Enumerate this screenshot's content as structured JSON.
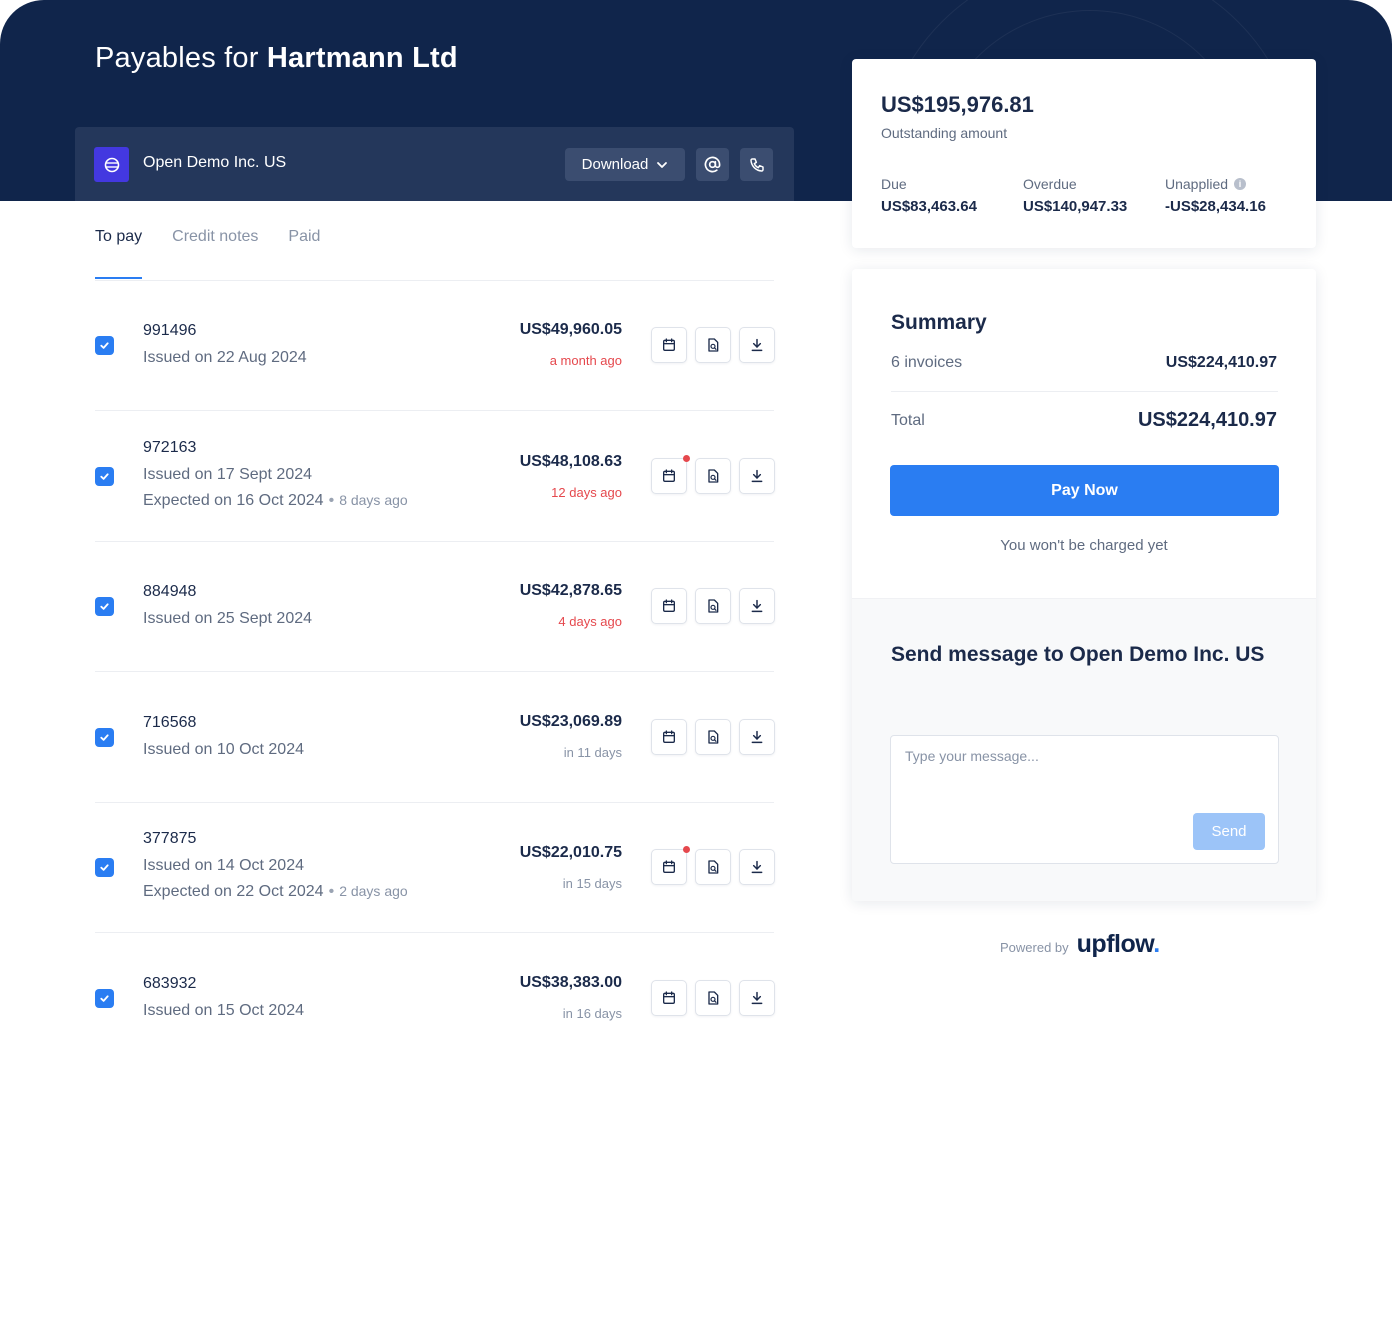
{
  "header": {
    "title_prefix": "Payables for",
    "title_company": "Hartmann Ltd"
  },
  "vendor": {
    "name": "Open Demo Inc. US",
    "download_label": "Download",
    "icons": [
      "globe-icon",
      "chevron-down-icon",
      "at-sign-icon",
      "phone-icon"
    ]
  },
  "tabs": [
    {
      "label": "To pay",
      "active": true
    },
    {
      "label": "Credit notes",
      "active": false
    },
    {
      "label": "Paid",
      "active": false
    }
  ],
  "invoices": [
    {
      "id": "991496",
      "issued": "Issued on 22 Aug 2024",
      "expected": "",
      "expected_ago": "",
      "amount": "US$49,960.05",
      "due": "a month ago",
      "overdue": true,
      "calendar_flag": false,
      "checked": true
    },
    {
      "id": "972163",
      "issued": "Issued on 17 Sept 2024",
      "expected": "Expected on 16 Oct 2024",
      "expected_ago": "8 days ago",
      "amount": "US$48,108.63",
      "due": "12 days ago",
      "overdue": true,
      "calendar_flag": true,
      "checked": true
    },
    {
      "id": "884948",
      "issued": "Issued on 25 Sept 2024",
      "expected": "",
      "expected_ago": "",
      "amount": "US$42,878.65",
      "due": "4 days ago",
      "overdue": true,
      "calendar_flag": false,
      "checked": true
    },
    {
      "id": "716568",
      "issued": "Issued on 10 Oct 2024",
      "expected": "",
      "expected_ago": "",
      "amount": "US$23,069.89",
      "due": "in 11 days",
      "overdue": false,
      "calendar_flag": false,
      "checked": true
    },
    {
      "id": "377875",
      "issued": "Issued on 14 Oct 2024",
      "expected": "Expected on 22 Oct 2024",
      "expected_ago": "2 days ago",
      "amount": "US$22,010.75",
      "due": "in 15 days",
      "overdue": false,
      "calendar_flag": true,
      "checked": true
    },
    {
      "id": "683932",
      "issued": "Issued on 15 Oct 2024",
      "expected": "",
      "expected_ago": "",
      "amount": "US$38,383.00",
      "due": "in 16 days",
      "overdue": false,
      "calendar_flag": false,
      "checked": true
    }
  ],
  "outstanding": {
    "amount": "US$195,976.81",
    "label": "Outstanding amount",
    "due_label": "Due",
    "due_value": "US$83,463.64",
    "overdue_label": "Overdue",
    "overdue_value": "US$140,947.33",
    "unapplied_label": "Unapplied",
    "unapplied_value": "-US$28,434.16"
  },
  "summary": {
    "title": "Summary",
    "invoices_label": "6 invoices",
    "invoices_value": "US$224,410.97",
    "total_label": "Total",
    "total_value": "US$224,410.97",
    "pay_label": "Pay Now",
    "charge_note": "You won't be charged yet"
  },
  "message": {
    "title": "Send message to Open Demo Inc. US",
    "placeholder": "Type your message...",
    "send_label": "Send"
  },
  "footer": {
    "powered_by": "Powered by",
    "brand": "upflow",
    "brand_dot": "."
  },
  "colors": {
    "header_bg": "#10254b",
    "accent": "#2a7df2",
    "overdue": "#e5484d",
    "vendor_logo": "#4338e0"
  }
}
